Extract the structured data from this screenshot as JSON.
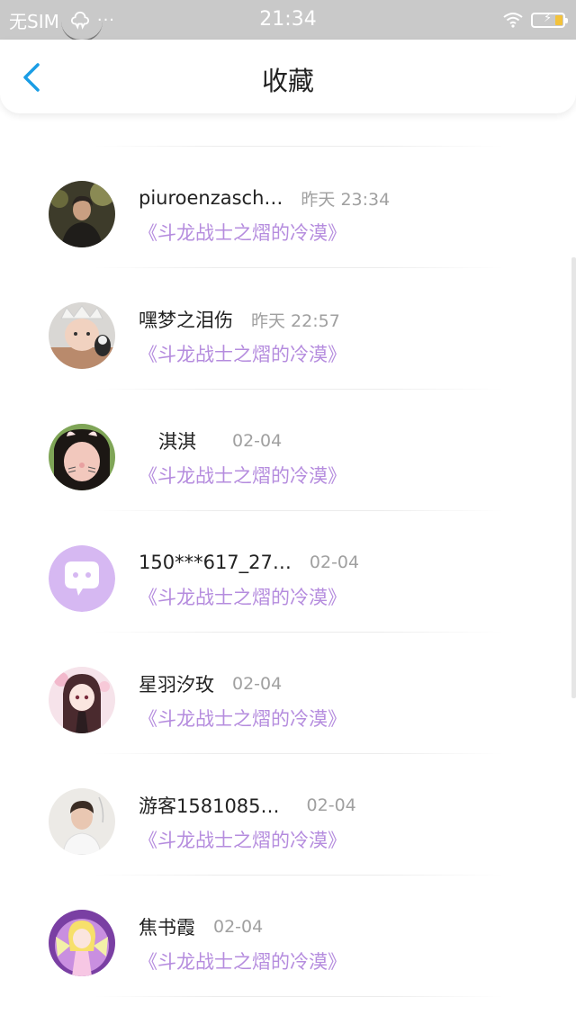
{
  "status_bar": {
    "carrier": "无SIM",
    "dots": "···",
    "time": "21:34",
    "icons": [
      "cloud-icon",
      "wifi-icon",
      "battery-icon"
    ],
    "battery_accent": "#f3c23b"
  },
  "header": {
    "title": "收藏",
    "back_icon": "chevron-left-icon",
    "accent": "#1a9de5"
  },
  "favorites": [
    {
      "username": "piuroenzasch…",
      "time": "昨天 23:34",
      "book": "《斗龙战士之熠的冷漠》",
      "avatar": "avatar-photo-young-man"
    },
    {
      "username": "嘿梦之泪伤",
      "time": "昨天 22:57",
      "book": "《斗龙战士之熠的冷漠》",
      "avatar": "avatar-photo-baby"
    },
    {
      "username": "淇淇",
      "time": "02-04",
      "book": "《斗龙战士之熠的冷漠》",
      "avatar": "avatar-photo-girl-filter"
    },
    {
      "username": "150***617_27…",
      "time": "02-04",
      "book": "《斗龙战士之熠的冷漠》",
      "avatar": "default-avatar-icon"
    },
    {
      "username": "星羽汐玫",
      "time": "02-04",
      "book": "《斗龙战士之熠的冷漠》",
      "avatar": "avatar-anime-girl"
    },
    {
      "username": "游客1581085…",
      "time": "02-04",
      "book": "《斗龙战士之熠的冷漠》",
      "avatar": "avatar-photo-boy"
    },
    {
      "username": "焦书霞",
      "time": "02-04",
      "book": "《斗龙战士之熠的冷漠》",
      "avatar": "avatar-anime-angel"
    }
  ],
  "colors": {
    "book_link": "#b58cde",
    "time_text": "#a0a0a0",
    "default_avatar_bg": "#d6b8f2"
  }
}
